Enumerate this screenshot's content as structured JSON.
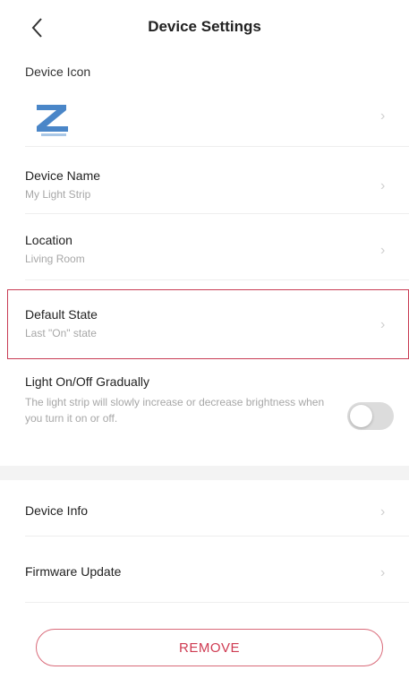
{
  "header": {
    "title": "Device Settings",
    "back_icon": "chevron-left-icon"
  },
  "device_icon": {
    "label": "Device Icon",
    "logo_icon": "z-logo-icon"
  },
  "device_name": {
    "label": "Device Name",
    "value": "My Light Strip"
  },
  "location": {
    "label": "Location",
    "value": "Living Room"
  },
  "default_state": {
    "label": "Default State",
    "value": "Last \"On\" state"
  },
  "gradual": {
    "label": "Light On/Off Gradually",
    "description": "The light strip will slowly increase or decrease brightness when you turn it on or off.",
    "toggle_on": false
  },
  "device_info": {
    "label": "Device Info"
  },
  "firmware": {
    "label": "Firmware Update"
  },
  "remove_button": {
    "label": "REMOVE"
  },
  "colors": {
    "accent": "#cf3b52",
    "highlight_border": "#c93d55",
    "secondary_text": "#a7a7a7"
  }
}
